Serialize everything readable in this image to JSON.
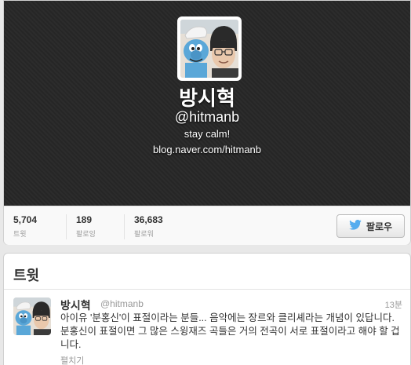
{
  "profile": {
    "name": "방시혁",
    "handle": "@hitmanb",
    "bio": "stay calm!",
    "website": "blog.naver.com/hitmanb"
  },
  "stats": [
    {
      "value": "5,704",
      "label": "트윗"
    },
    {
      "value": "189",
      "label": "팔로잉"
    },
    {
      "value": "36,683",
      "label": "팔로워"
    }
  ],
  "follow_button": {
    "label": "팔로우",
    "icon": "twitter-bird-icon"
  },
  "tweets_section": {
    "title": "트윗",
    "tweets": [
      {
        "name": "방시혁",
        "handle": "@hitmanb",
        "time": "13분",
        "text": "아이유 '분홍신'이 표절이라는 분들... 음악에는 장르와 클리셰라는 개념이 있답니다. 분홍신이 표절이면 그 많은 스윙재즈 곡들은 거의 전곡이 서로 표절이라고 해야 할 겁니다.",
        "expand": "펼치기"
      }
    ]
  },
  "colors": {
    "header_bg": "#262626",
    "twitter_blue": "#55acee"
  }
}
